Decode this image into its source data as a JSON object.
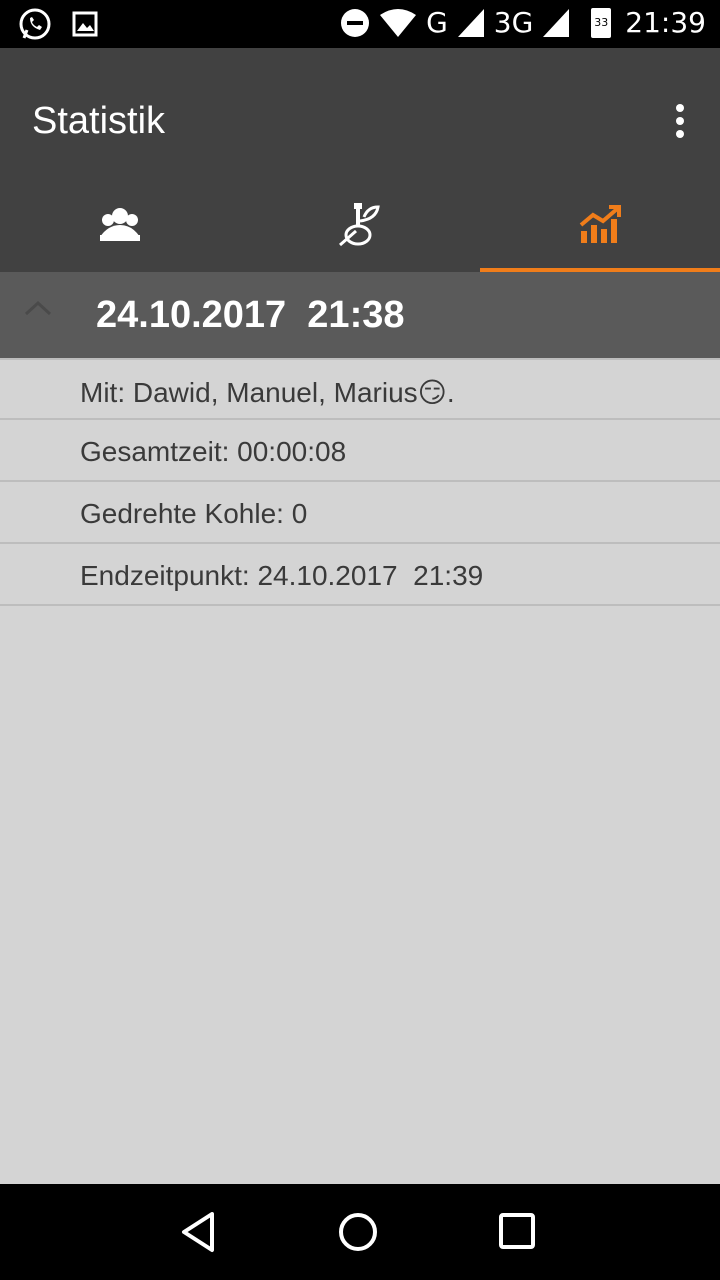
{
  "status_bar": {
    "network_1": "G",
    "network_2": "3G",
    "battery": "33",
    "time": "21:39"
  },
  "app_bar": {
    "title": "Statistik",
    "tabs": [
      {
        "icon": "people-icon",
        "active": false
      },
      {
        "icon": "hookah-icon",
        "active": false
      },
      {
        "icon": "statistics-chart-icon",
        "active": true
      }
    ],
    "accent_color": "#f07d1a"
  },
  "session": {
    "header": "24.10.2017  21:38",
    "items": [
      {
        "text": "Mit: Dawid, Manuel, Marius😏."
      },
      {
        "text": "Gesamtzeit: 00:00:08"
      },
      {
        "text": "Gedrehte Kohle: 0"
      },
      {
        "text": "Endzeitpunkt: 24.10.2017  21:39"
      }
    ]
  },
  "navbar": {
    "back": "back-icon",
    "home": "home-icon",
    "recents": "recents-icon"
  }
}
